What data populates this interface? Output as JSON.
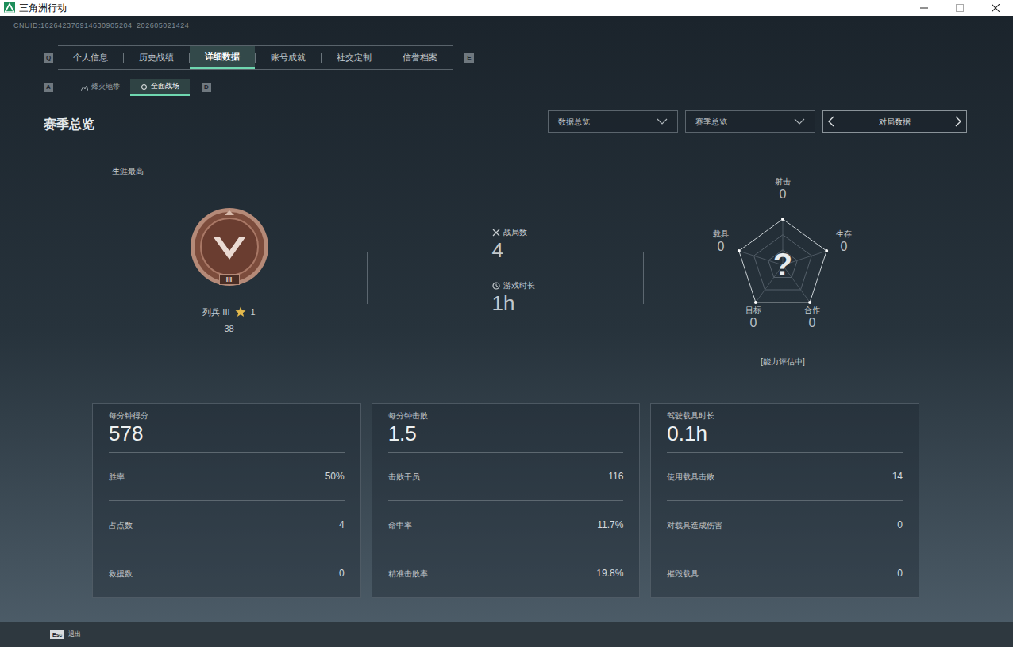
{
  "window": {
    "title": "三角洲行动"
  },
  "uid": "CNUID:162642376914630905204_202605021424",
  "tabs": {
    "prev_key": "Q",
    "next_key": "E",
    "items": [
      {
        "label": "个人信息",
        "selected": false
      },
      {
        "label": "历史战绩",
        "selected": false
      },
      {
        "label": "详细数据",
        "selected": true
      },
      {
        "label": "账号成就",
        "selected": false
      },
      {
        "label": "社交定制",
        "selected": false
      },
      {
        "label": "信誉档案",
        "selected": false
      }
    ]
  },
  "subtabs": {
    "prev_key": "A",
    "next_key": "D",
    "items": [
      {
        "label": "烽火地带",
        "selected": false
      },
      {
        "label": "全面战场",
        "selected": true
      }
    ]
  },
  "section_title": "赛季总览",
  "filters": [
    {
      "label": "数据总览"
    },
    {
      "label": "赛季总览"
    }
  ],
  "pager": {
    "label": "对局数据"
  },
  "rank": {
    "caption": "生涯最高",
    "badge_tier": "III",
    "name": "列兵 III",
    "star_count": "1",
    "score": "38"
  },
  "summary": [
    {
      "label": "战局数",
      "value": "4"
    },
    {
      "label": "游戏时长",
      "value": "1h"
    }
  ],
  "radar": {
    "center": "?",
    "status": "[能力评估中]",
    "axes": [
      {
        "label": "射击",
        "value": "0"
      },
      {
        "label": "生存",
        "value": "0"
      },
      {
        "label": "合作",
        "value": "0"
      },
      {
        "label": "目标",
        "value": "0"
      },
      {
        "label": "载具",
        "value": "0"
      }
    ]
  },
  "cards": [
    {
      "title": "每分钟得分",
      "value": "578",
      "rows": [
        {
          "label": "胜率",
          "value": "50%"
        },
        {
          "label": "占点数",
          "value": "4"
        },
        {
          "label": "救援数",
          "value": "0"
        }
      ]
    },
    {
      "title": "每分钟击败",
      "value": "1.5",
      "rows": [
        {
          "label": "击败干员",
          "value": "116"
        },
        {
          "label": "命中率",
          "value": "11.7%"
        },
        {
          "label": "精准击败率",
          "value": "19.8%"
        }
      ]
    },
    {
      "title": "驾驶载具时长",
      "value": "0.1h",
      "rows": [
        {
          "label": "使用载具击败",
          "value": "14"
        },
        {
          "label": "对载具造成伤害",
          "value": "0"
        },
        {
          "label": "摧毁载具",
          "value": "0"
        }
      ]
    }
  ],
  "footer": {
    "key": "Esc",
    "label": "退出"
  }
}
